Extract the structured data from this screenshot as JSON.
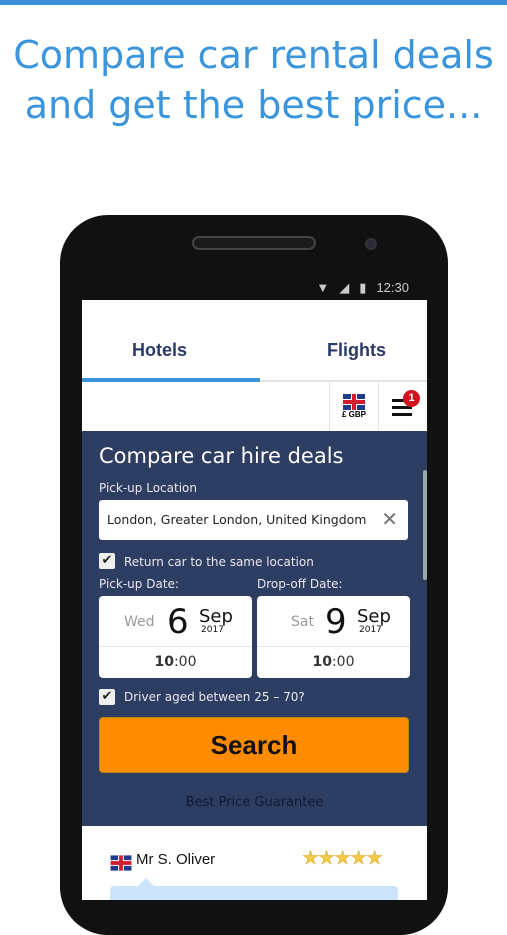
{
  "headline": "Compare car rental deals and get the best price...",
  "status_bar": {
    "time": "12:30",
    "icons": [
      "wifi-icon",
      "signal-icon",
      "battery-icon"
    ]
  },
  "tabs": [
    {
      "label": "Hotels",
      "active": true
    },
    {
      "label": "Flights",
      "active": false
    }
  ],
  "currency": {
    "flag": "uk-flag-icon",
    "label": "£ GBP"
  },
  "menu": {
    "badge": "1"
  },
  "form": {
    "title": "Compare car hire deals",
    "pickup_label": "Pick-up Location",
    "pickup_value": "London, Greater London, United Kingdom",
    "same_location_label": "Return car to the same location",
    "same_location_checked": true,
    "pickup_date_label": "Pick-up Date:",
    "dropoff_date_label": "Drop-off Date:",
    "pickup": {
      "dow": "Wed",
      "day": "6",
      "month": "Sep",
      "year": "2017",
      "hour": "10",
      "min": ":00"
    },
    "dropoff": {
      "dow": "Sat",
      "day": "9",
      "month": "Sep",
      "year": "2017",
      "hour": "10",
      "min": ":00"
    },
    "driver_age_label": "Driver aged between 25 – 70?",
    "driver_age_checked": true,
    "search_label": "Search",
    "guarantee": "Best Price Guarantee"
  },
  "review": {
    "name": "Mr S. Oliver",
    "stars": "★★★★★",
    "rating": 5
  },
  "colors": {
    "accent": "#3a95dc",
    "form_bg": "#2e3d62",
    "search": "#ff8c00",
    "tab_text": "#2b3a67"
  }
}
